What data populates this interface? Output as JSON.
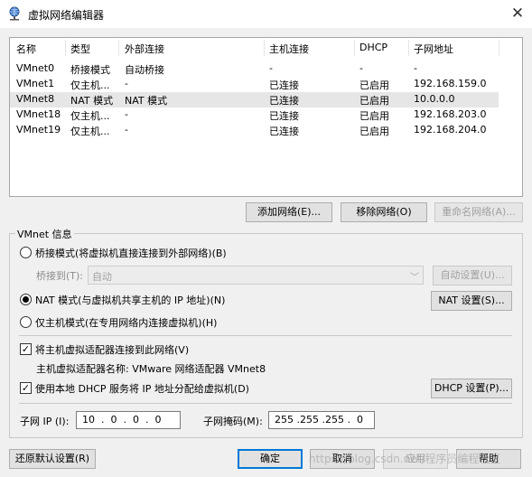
{
  "window": {
    "title": "虚拟网络编辑器",
    "close": "✕"
  },
  "table": {
    "columns": [
      "名称",
      "类型",
      "外部连接",
      "主机连接",
      "DHCP",
      "子网地址"
    ],
    "rows": [
      {
        "name": "VMnet0",
        "type": "桥接模式",
        "external": "自动桥接",
        "host": "-",
        "dhcp": "-",
        "subnet": "-",
        "selected": false
      },
      {
        "name": "VMnet1",
        "type": "仅主机...",
        "external": "-",
        "host": "已连接",
        "dhcp": "已启用",
        "subnet": "192.168.159.0",
        "selected": false
      },
      {
        "name": "VMnet8",
        "type": "NAT 模式",
        "external": "NAT 模式",
        "host": "已连接",
        "dhcp": "已启用",
        "subnet": "10.0.0.0",
        "selected": true
      },
      {
        "name": "VMnet18",
        "type": "仅主机...",
        "external": "-",
        "host": "已连接",
        "dhcp": "已启用",
        "subnet": "192.168.203.0",
        "selected": false
      },
      {
        "name": "VMnet19",
        "type": "仅主机...",
        "external": "-",
        "host": "已连接",
        "dhcp": "已启用",
        "subnet": "192.168.204.0",
        "selected": false
      }
    ]
  },
  "table_buttons": {
    "add": "添加网络(E)...",
    "remove": "移除网络(O)",
    "rename": "重命名网络(A)..."
  },
  "vmnet_info": {
    "title": "VMnet 信息",
    "bridge_radio": "桥接模式(将虚拟机直接连接到外部网络)(B)",
    "bridge_to_label": "桥接到(T):",
    "bridge_to_value": "自动",
    "auto_settings": "自动设置(U)...",
    "nat_radio": "NAT 模式(与虚拟机共享主机的 IP 地址)(N)",
    "nat_settings": "NAT 设置(S)...",
    "hostonly_radio": "仅主机模式(在专用网络内连接虚拟机)(H)",
    "selected_mode": "nat",
    "connect_adapter_check": "将主机虚拟适配器连接到此网络(V)",
    "adapter_name_label": "主机虚拟适配器名称: VMware 网络适配器 VMnet8",
    "dhcp_check": "使用本地 DHCP 服务将 IP 地址分配给虚拟机(D)",
    "dhcp_settings": "DHCP 设置(P)...",
    "subnet_ip_label": "子网 IP (I):",
    "subnet_ip_value": "10  .  0  .  0  .  0",
    "subnet_mask_label": "子网掩码(M):",
    "subnet_mask_value": "255 .255 .255 .  0"
  },
  "footer": {
    "restore_defaults": "还原默认设置(R)",
    "ok": "确定",
    "cancel": "取消",
    "apply": "应用",
    "help": "帮助"
  },
  "watermark": "https://blog.csdn.net/程序员编程社区"
}
